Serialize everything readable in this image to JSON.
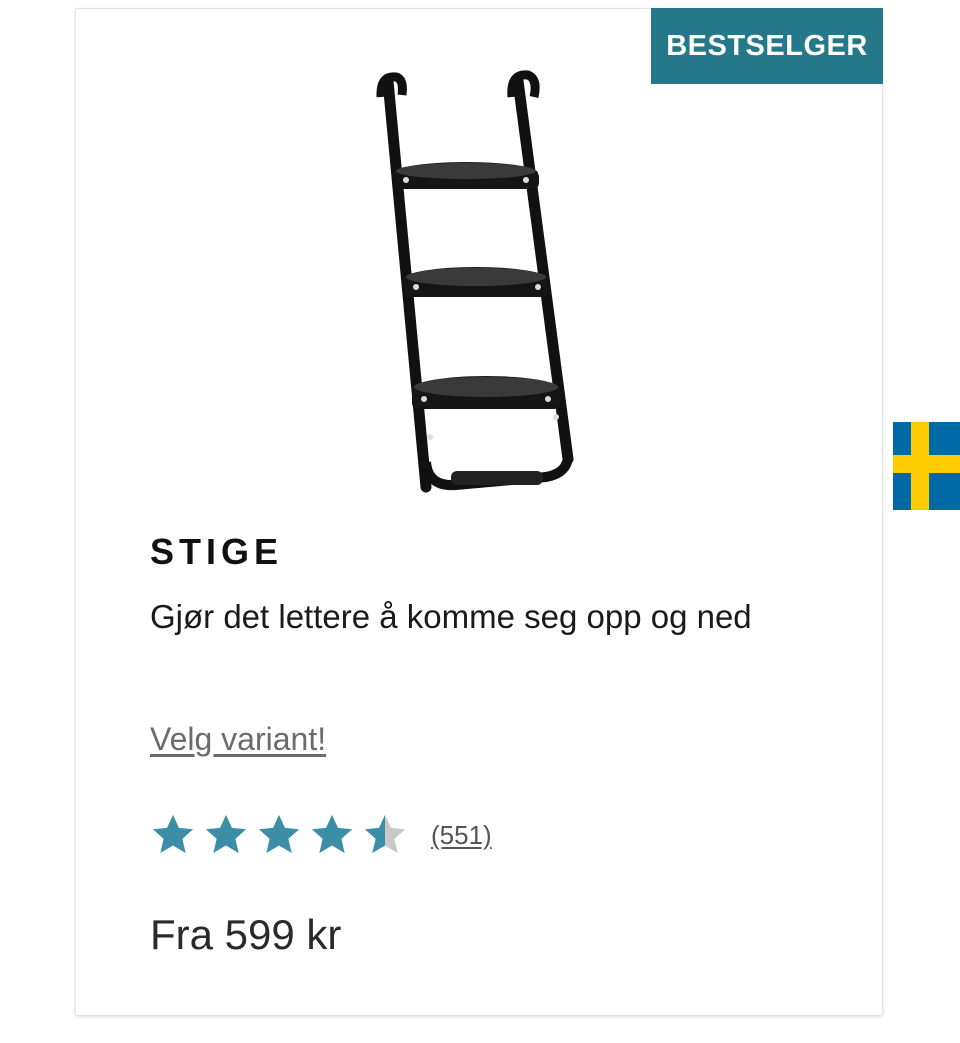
{
  "product": {
    "badge": "BESTSELGER",
    "image_alt": "ladder-product-image",
    "title": "STIGE",
    "subtitle": "Gjør det lettere å komme seg opp og ned",
    "variant_link": "Velg variant!",
    "rating": {
      "value": 4.5,
      "max": 5,
      "review_count": "(551)"
    },
    "price": "Fra 599 kr"
  },
  "colors": {
    "badge_bg": "#25788a",
    "star_filled": "#3b8ea5",
    "star_empty": "#c8c8c8",
    "flag_blue": "#006aa7",
    "flag_yellow": "#fecc00"
  },
  "side_flag": {
    "icon": "sweden-flag-icon"
  }
}
